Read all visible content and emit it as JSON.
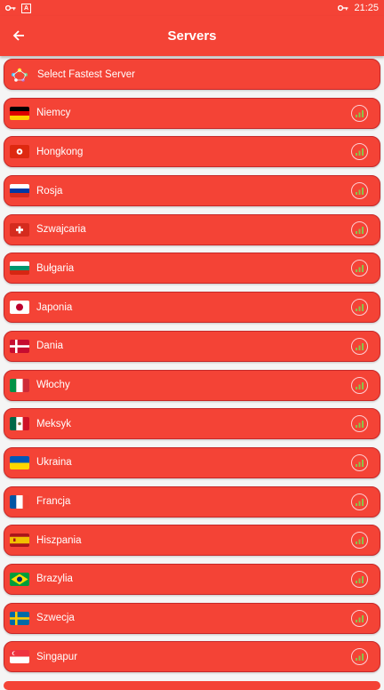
{
  "statusbar": {
    "time": "21:25",
    "notification_badge": "A"
  },
  "appbar": {
    "title": "Servers"
  },
  "fastest": {
    "label": "Select Fastest Server"
  },
  "servers": [
    {
      "label": "Niemcy",
      "flag": "germany"
    },
    {
      "label": "Hongkong",
      "flag": "hongkong"
    },
    {
      "label": "Rosja",
      "flag": "russia"
    },
    {
      "label": "Szwajcaria",
      "flag": "switzerland"
    },
    {
      "label": "Bułgaria",
      "flag": "bulgaria"
    },
    {
      "label": "Japonia",
      "flag": "japan"
    },
    {
      "label": "Dania",
      "flag": "denmark"
    },
    {
      "label": "Włochy",
      "flag": "italy"
    },
    {
      "label": "Meksyk",
      "flag": "mexico"
    },
    {
      "label": "Ukraina",
      "flag": "ukraine"
    },
    {
      "label": "Francja",
      "flag": "france"
    },
    {
      "label": "Hiszpania",
      "flag": "spain"
    },
    {
      "label": "Brazylia",
      "flag": "brazil"
    },
    {
      "label": "Szwecja",
      "flag": "sweden"
    },
    {
      "label": "Singapur",
      "flag": "singapore"
    }
  ],
  "colors": {
    "primary": "#f44336",
    "signal": "#8bc34a"
  },
  "icons": {
    "back": "arrow-left-icon",
    "signal": "signal-strength-icon",
    "fastest": "fastest-server-icon"
  }
}
